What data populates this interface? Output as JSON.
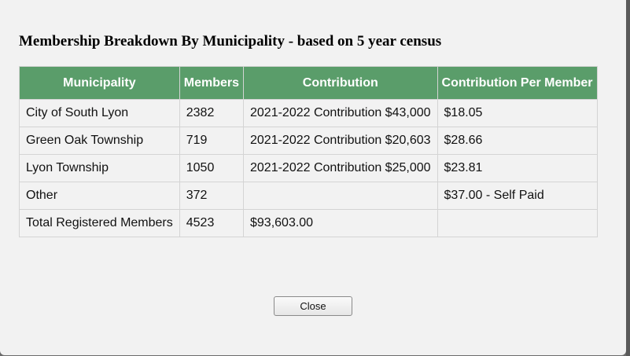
{
  "dialog": {
    "title": "Membership Breakdown By Municipality - based on 5 year census",
    "close_label": "Close"
  },
  "table": {
    "headers": [
      "Municipality",
      "Members",
      "Contribution",
      "Contribution Per Member"
    ],
    "rows": [
      [
        "City of South Lyon",
        "2382",
        "2021-2022 Contribution $43,000",
        "$18.05"
      ],
      [
        "Green Oak Township",
        "719",
        "2021-2022 Contribution $20,603",
        "$28.66"
      ],
      [
        "Lyon Township",
        "1050",
        "2021-2022 Contribution $25,000",
        "$23.81"
      ],
      [
        "Other",
        "372",
        "",
        "$37.00 - Self Paid"
      ],
      [
        "Total Registered Members",
        "4523",
        "$93,603.00",
        ""
      ]
    ]
  },
  "colors": {
    "header_bg": "#5a9d6a",
    "dialog_bg": "#f2f2f2"
  }
}
